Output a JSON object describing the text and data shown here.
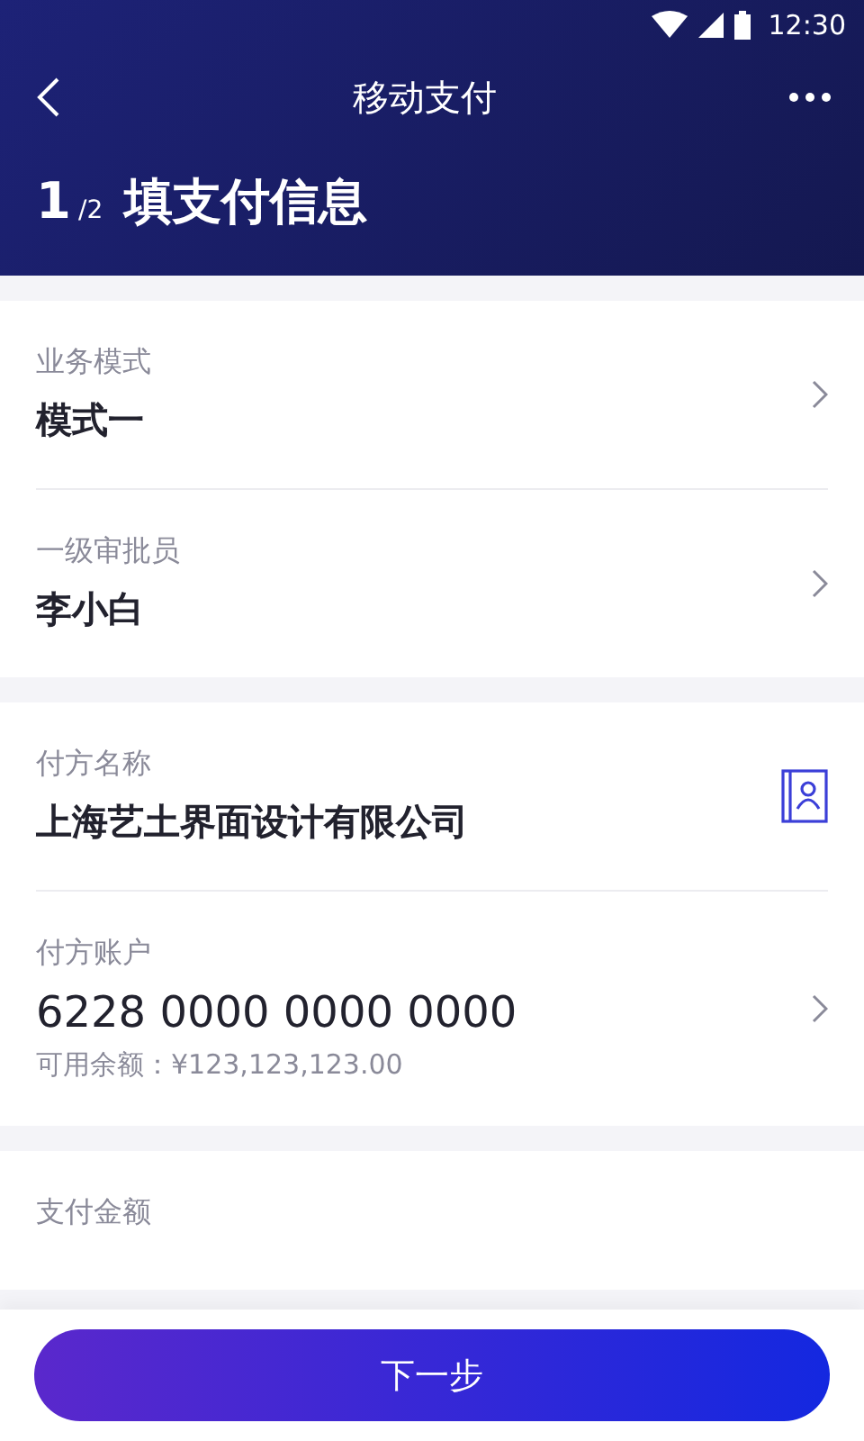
{
  "status_bar": {
    "time": "12:30"
  },
  "nav": {
    "title": "移动支付"
  },
  "step": {
    "current": "1",
    "total": "/2",
    "title": "填支付信息"
  },
  "sections": [
    {
      "rows": [
        {
          "kind": "select",
          "label": "业务模式",
          "value": "模式一"
        },
        {
          "kind": "select",
          "label": "一级审批员",
          "value": "李小白"
        }
      ]
    },
    {
      "rows": [
        {
          "kind": "contact",
          "label": "付方名称",
          "value": "上海艺土界面设计有限公司"
        },
        {
          "kind": "account",
          "label": "付方账户",
          "value": "6228 0000 0000 0000",
          "note": "可用余额：¥123,123,123.00"
        }
      ]
    },
    {
      "rows": [
        {
          "kind": "amount",
          "label": "支付金额"
        }
      ]
    }
  ],
  "footer": {
    "button": "下一步"
  }
}
